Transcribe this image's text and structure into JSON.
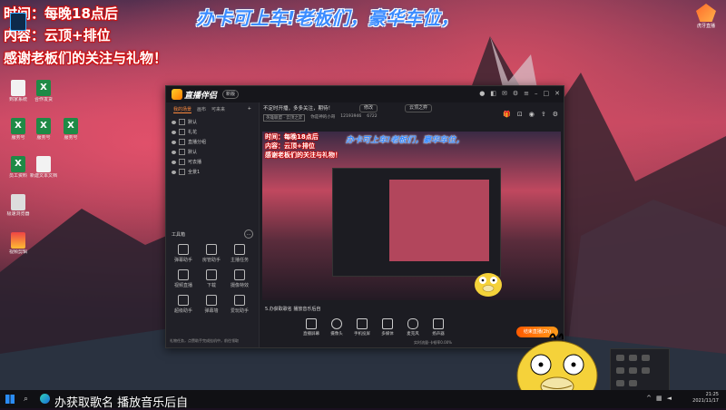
{
  "overlay": {
    "line1": "时间：每晚18点后",
    "line2": "内容：云顶+排位",
    "line3": "感谢老板们的关注与礼物！",
    "banner": "办卡可上车!老板们，豪华车位，"
  },
  "desktop": {
    "top_right_logo_label": "虎牙直播",
    "icons": [
      {
        "label": "Photosh..."
      },
      {
        "label": "到家系统"
      },
      {
        "label": "合作发货"
      },
      {
        "label": "服务号"
      },
      {
        "label": "员工资料"
      },
      {
        "label": "新建文本文档"
      },
      {
        "label": "极速浏览器"
      },
      {
        "label": "视频剪辑"
      }
    ]
  },
  "app": {
    "name": "直播伴侣",
    "version": "新版",
    "tabs": [
      "我的场景",
      "画布",
      "可来来"
    ],
    "scenes": [
      "默认",
      "礼花",
      "直播分组",
      "默认",
      "可去播",
      "全景1"
    ],
    "tools_title": "工具箱",
    "tools": [
      {
        "label": "弹幕助手"
      },
      {
        "label": "房管助手"
      },
      {
        "label": "主播任务"
      },
      {
        "label": "视频直播"
      },
      {
        "label": "下载"
      },
      {
        "label": "摄像特效"
      },
      {
        "label": "超级助手"
      },
      {
        "label": "弹幕墙"
      },
      {
        "label": "爱玩助手"
      }
    ],
    "left_footer": "礼物任务，点赞助手完成挂机中，前往领取",
    "top_info": "不定时开播，多多关注，期待！",
    "tag_button": "修改",
    "category_button": "云顶之弈",
    "meta": [
      "英雄联盟 · 云顶之弈",
      "你是神的小哥",
      "12193946",
      "6722"
    ],
    "scene_name": "5.办获取歌名 播放音乐后自",
    "controls": [
      {
        "label": "直播屏幕"
      },
      {
        "label": "摄像头"
      },
      {
        "label": "手机投屏"
      },
      {
        "label": "多媒体"
      },
      {
        "label": "麦克风"
      },
      {
        "label": "扬声器"
      }
    ],
    "live_button": "结束直播(2h)",
    "hold_text": "实时流量·卡顿率0.00%"
  },
  "taskbar": {
    "ticker": "办获取歌名 播放音乐后自",
    "time": "21:25",
    "date": "2021/11/17"
  },
  "colors": {
    "overlay_text_stroke": "#d01010",
    "banner_blue": "#3b8cff",
    "live_orange": "#ff7a10"
  }
}
